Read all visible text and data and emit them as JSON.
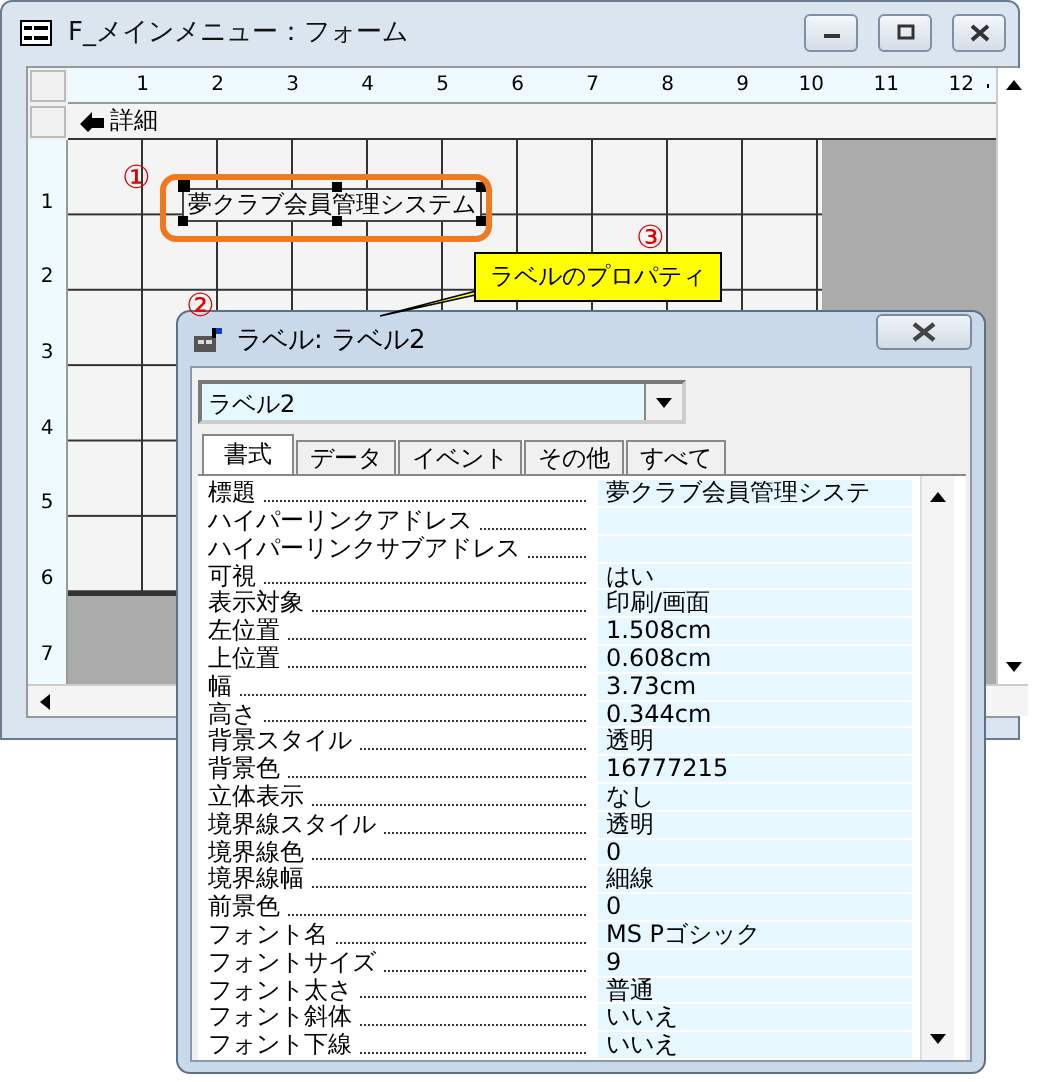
{
  "window": {
    "title": "F_メインメニュー：フォーム"
  },
  "ruler": {
    "horizontal": [
      "1",
      "2",
      "3",
      "4",
      "5",
      "6",
      "7",
      "8",
      "9",
      "10",
      "11",
      "12"
    ],
    "vertical": [
      "1",
      "2",
      "3",
      "4",
      "5",
      "6",
      "7"
    ]
  },
  "section": {
    "title": "詳細"
  },
  "label_control": {
    "text": "夢クラブ会員管理システム",
    "selected": true
  },
  "annotations": [
    {
      "text": "①"
    },
    {
      "text": "②"
    },
    {
      "text": "③"
    }
  ],
  "callout": {
    "text": "ラベルのプロパティ"
  },
  "property_sheet": {
    "title": "ラベル: ラベル2",
    "object": "ラベル2",
    "tabs": [
      {
        "label": "書式",
        "selected": true
      },
      {
        "label": "データ",
        "selected": false
      },
      {
        "label": "イベント",
        "selected": false
      },
      {
        "label": "その他",
        "selected": false
      },
      {
        "label": "すべて",
        "selected": false
      }
    ],
    "properties": [
      {
        "name": "標題",
        "value": "夢クラブ会員管理システ"
      },
      {
        "name": "ハイパーリンクアドレス"
      },
      {
        "name": "ハイパーリンクサブアドレス"
      },
      {
        "name": "可視",
        "value": "はい"
      },
      {
        "name": "表示対象",
        "value": "印刷/画面"
      },
      {
        "name": "左位置",
        "value": "1.508cm"
      },
      {
        "name": "上位置",
        "value": "0.608cm"
      },
      {
        "name": "幅",
        "value": "3.73cm"
      },
      {
        "name": "高さ",
        "value": "0.344cm"
      },
      {
        "name": "背景スタイル",
        "value": "透明"
      },
      {
        "name": "背景色",
        "value": "16777215"
      },
      {
        "name": "立体表示",
        "value": "なし"
      },
      {
        "name": "境界線スタイル",
        "value": "透明"
      },
      {
        "name": "境界線色",
        "value": "0"
      },
      {
        "name": "境界線幅",
        "value": "細線"
      },
      {
        "name": "前景色",
        "value": "0"
      },
      {
        "name": "フォント名",
        "value": "MS Pゴシック"
      },
      {
        "name": "フォントサイズ",
        "value": "9"
      },
      {
        "name": "フォント太さ",
        "value": "普通"
      },
      {
        "name": "フォント斜体",
        "value": "いいえ"
      },
      {
        "name": "フォント下線",
        "value": "いいえ"
      }
    ]
  }
}
